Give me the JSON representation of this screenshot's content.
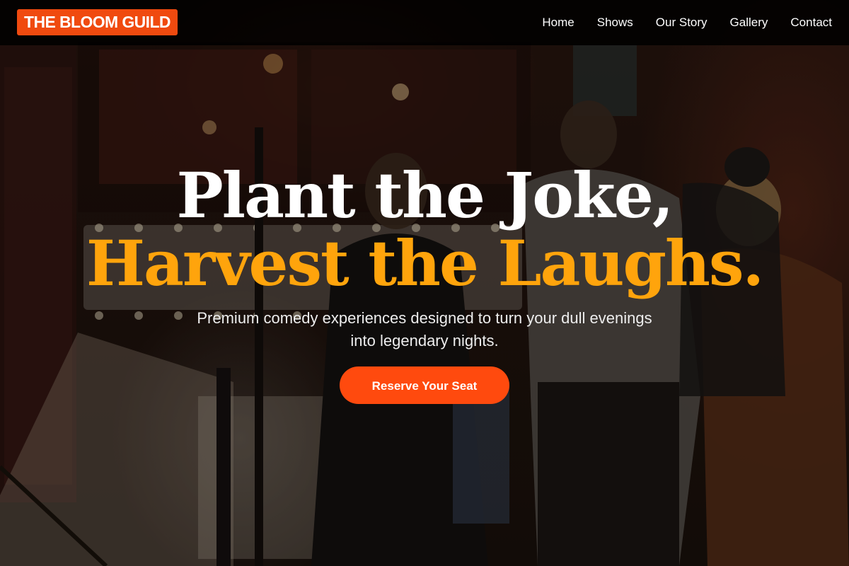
{
  "brand": {
    "logo_text": "THE BLOOM GUILD"
  },
  "nav": {
    "items": [
      {
        "label": "Home"
      },
      {
        "label": "Shows"
      },
      {
        "label": "Our Story"
      },
      {
        "label": "Gallery"
      },
      {
        "label": "Contact"
      }
    ]
  },
  "hero": {
    "headline_line1": "Plant the Joke,",
    "headline_line2": "Harvest the Laughs.",
    "subtitle": "Premium comedy experiences designed to turn your dull evenings into legendary nights.",
    "cta_label": "Reserve Your Seat",
    "background_photo": "comedy-club-entrance-photo"
  },
  "colors": {
    "brand_accent": "#f04a0f",
    "cta": "#ff4a0e",
    "headline_highlight": "#ffa40c",
    "navbar_bg": "#000000"
  }
}
